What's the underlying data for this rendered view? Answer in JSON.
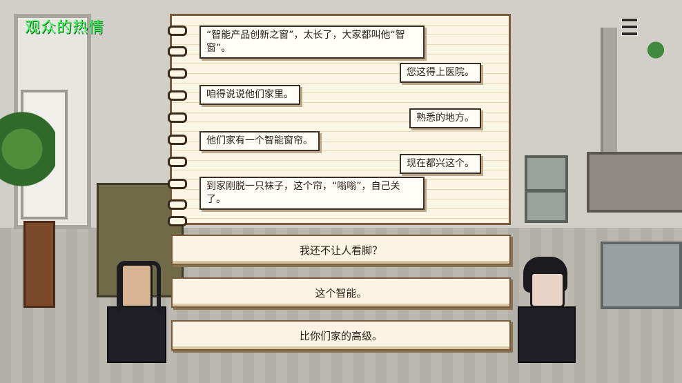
{
  "hud": {
    "title": "观众的热情",
    "menu_icon": "hamburger-menu-icon"
  },
  "dialogue": [
    {
      "speaker": "left",
      "text": "“智能产品创新之窗”，太长了，大家都叫他“智窗”。"
    },
    {
      "speaker": "right",
      "text": "您这得上医院。"
    },
    {
      "speaker": "left",
      "text": "咱得说说他们家里。"
    },
    {
      "speaker": "right",
      "text": "熟悉的地方。"
    },
    {
      "speaker": "left",
      "text": "他们家有一个智能窗帘。"
    },
    {
      "speaker": "right",
      "text": "现在都兴这个。"
    },
    {
      "speaker": "left",
      "text": "到家刚脱一只袜子，这个帘，“嗡嗡”，自己关了。"
    }
  ],
  "choices": [
    {
      "label": "我还不让人看脚？"
    },
    {
      "label": "这个智能。"
    },
    {
      "label": "比你们家的高级。"
    }
  ]
}
